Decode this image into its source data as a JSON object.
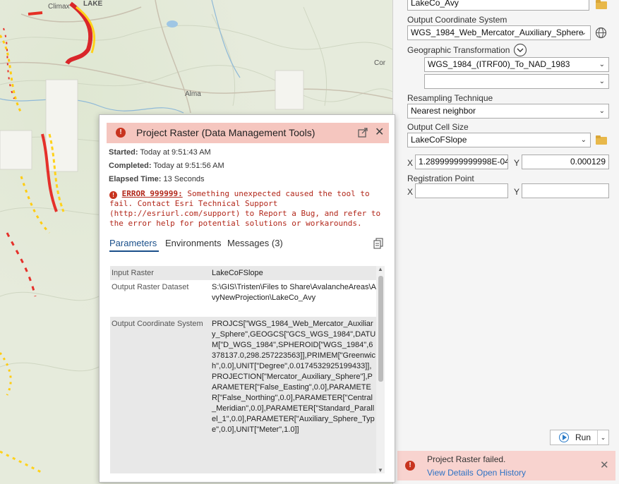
{
  "map": {
    "labels": [
      "Climax",
      "LAKE",
      "Alma",
      "Cor"
    ]
  },
  "pane": {
    "output_raster_value": "LakeCo_Avy",
    "output_cs_label": "Output Coordinate System",
    "output_cs_value": "WGS_1984_Web_Mercator_Auxiliary_Sphere",
    "geo_transform_label": "Geographic Transformation",
    "geo_transform_value": "WGS_1984_(ITRF00)_To_NAD_1983",
    "geo_transform_value2": "",
    "resampling_label": "Resampling Technique",
    "resampling_value": "Nearest neighbor",
    "cell_size_label": "Output Cell Size",
    "cell_size_value": "LakeCoFSlope",
    "x_label": "X",
    "y_label": "Y",
    "cell_x": "1.28999999999998E-04",
    "cell_y": "0.000129",
    "registration_label": "Registration Point",
    "reg_x": "",
    "reg_y": "",
    "run_label": "Run",
    "fail_title": "Project Raster failed.",
    "view_details": "View Details",
    "open_history": "Open History"
  },
  "dialog": {
    "title": "Project Raster (Data Management Tools)",
    "started_label": "Started:",
    "started_value": "Today at 9:51:43 AM",
    "completed_label": "Completed:",
    "completed_value": "Today at 9:51:56 AM",
    "elapsed_label": "Elapsed Time:",
    "elapsed_value": "13 Seconds",
    "error_code": "ERROR 999999:",
    "error_message": "Something unexpected caused the tool to fail. Contact Esri Technical Support (http://esriurl.com/support) to Report a Bug, and refer to the error help for potential solutions or workarounds.",
    "tabs": [
      "Parameters",
      "Environments",
      "Messages (3)"
    ],
    "params": [
      {
        "key": "Input Raster",
        "value": "LakeCoFSlope"
      },
      {
        "key": "Output Raster Dataset",
        "value": "S:\\GIS\\Tristen\\Files to Share\\AvalancheAreas\\AvyNewProjection\\LakeCo_Avy"
      },
      {
        "key": "Output Coordinate System",
        "value": "PROJCS[\"WGS_1984_Web_Mercator_Auxiliary_Sphere\",GEOGCS[\"GCS_WGS_1984\",DATUM[\"D_WGS_1984\",SPHEROID[\"WGS_1984\",6378137.0,298.257223563]],PRIMEM[\"Greenwich\",0.0],UNIT[\"Degree\",0.0174532925199433]],PROJECTION[\"Mercator_Auxiliary_Sphere\"],PARAMETER[\"False_Easting\",0.0],PARAMETER[\"False_Northing\",0.0],PARAMETER[\"Central_Meridian\",0.0],PARAMETER[\"Standard_Parallel_1\",0.0],PARAMETER[\"Auxiliary_Sphere_Type\",0.0],UNIT[\"Meter\",1.0]]"
      }
    ]
  }
}
